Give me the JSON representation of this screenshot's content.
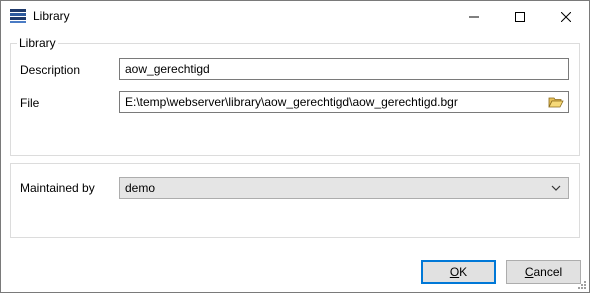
{
  "window": {
    "title": "Library"
  },
  "group1": {
    "legend": "Library"
  },
  "description": {
    "label": "Description",
    "value": "aow_gerechtigd"
  },
  "file": {
    "label": "File",
    "value": "E:\\temp\\webserver\\library\\aow_gerechtigd\\aow_gerechtigd.bgr"
  },
  "maintained_by": {
    "label": "Maintained by",
    "selected": "demo"
  },
  "buttons": {
    "ok_access": "O",
    "ok_rest": "K",
    "cancel_access": "C",
    "cancel_rest": "ancel"
  },
  "colors": {
    "accent": "#0078d7",
    "button_bg": "#e1e1e1",
    "combo_bg": "#e5e5e5"
  }
}
